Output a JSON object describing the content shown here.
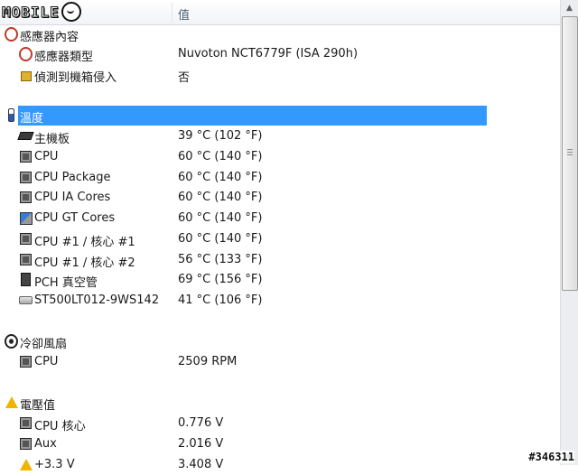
{
  "header": {
    "logo_text": "MOBILE",
    "value_col": "值"
  },
  "sections": [
    {
      "title": "感應器內容",
      "icon": "sensor-icon",
      "items": [
        {
          "label": "感應器類型",
          "value": "Nuvoton NCT6779F  (ISA 290h)",
          "icon": "sensor-icon"
        },
        {
          "label": "偵測到機箱侵入",
          "value": "否",
          "icon": "lock-icon"
        }
      ]
    },
    {
      "title": "溫度",
      "icon": "thermometer-icon",
      "items": [
        {
          "label": "主機板",
          "value": "39 °C  (102 °F)",
          "icon": "motherboard-icon"
        },
        {
          "label": "CPU",
          "value": "60 °C  (140 °F)",
          "icon": "cpu-icon"
        },
        {
          "label": "CPU Package",
          "value": "60 °C  (140 °F)",
          "icon": "cpu-icon"
        },
        {
          "label": "CPU IA Cores",
          "value": "60 °C  (140 °F)",
          "icon": "cpu-icon"
        },
        {
          "label": "CPU GT Cores",
          "value": "60 °C  (140 °F)",
          "icon": "gpu-icon"
        },
        {
          "label": "CPU #1 / 核心 #1",
          "value": "60 °C  (140 °F)",
          "icon": "cpu-icon"
        },
        {
          "label": "CPU #1 / 核心 #2",
          "value": "56 °C  (133 °F)",
          "icon": "cpu-icon"
        },
        {
          "label": "PCH 真空管",
          "value": "69 °C  (156 °F)",
          "icon": "chipset-icon"
        },
        {
          "label": "ST500LT012-9WS142",
          "value": "41 °C  (106 °F)",
          "icon": "hard-disk-icon"
        }
      ]
    },
    {
      "title": "冷卻風扇",
      "icon": "fan-icon",
      "items": [
        {
          "label": "CPU",
          "value": "2509 RPM",
          "icon": "cpu-icon"
        }
      ]
    },
    {
      "title": "電壓值",
      "icon": "warning-icon",
      "items": [
        {
          "label": "CPU 核心",
          "value": "0.776 V",
          "icon": "cpu-icon"
        },
        {
          "label": "Aux",
          "value": "2.016 V",
          "icon": "cpu-icon"
        },
        {
          "label": "+3.3 V",
          "value": "3.408 V",
          "icon": "warning-icon"
        }
      ]
    }
  ],
  "watermark": "#346311",
  "colors": {
    "selection": "#3399ff",
    "header_text": "#4c607a"
  }
}
